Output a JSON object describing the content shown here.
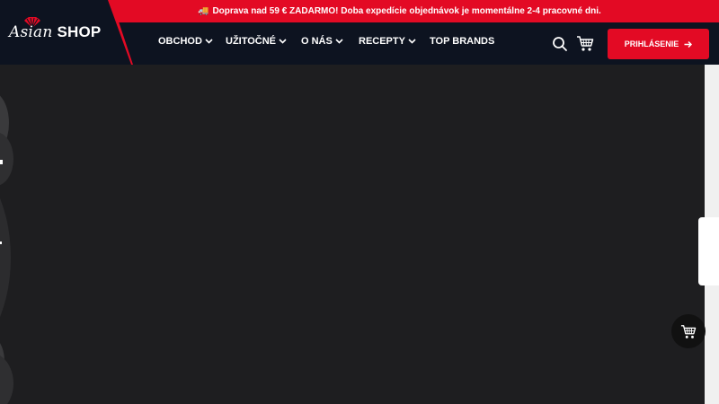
{
  "announcement": {
    "text": "Doprava nad 59 € ZADARMO! Doba expedície objednávok je momentálne 2-4 pracovné dni.",
    "icon": "truck-icon"
  },
  "brand": {
    "name_part1": "Asian",
    "name_part2": "SHOP",
    "logo_icon": "fan-icon"
  },
  "nav": {
    "items": [
      {
        "label": "OBCHOD",
        "has_dropdown": true
      },
      {
        "label": "UŽITOČNÉ",
        "has_dropdown": true
      },
      {
        "label": "O NÁS",
        "has_dropdown": true
      },
      {
        "label": "RECEPTY",
        "has_dropdown": true
      },
      {
        "label": "TOP BRANDS",
        "has_dropdown": false
      }
    ]
  },
  "header_actions": {
    "search_icon": "search-icon",
    "cart_icon": "cart-icon",
    "login_label": "PRIHLÁSENIE",
    "login_icon": "arrow-right-icon"
  },
  "floating": {
    "cart_icon": "cart-icon"
  },
  "colors": {
    "brand_red": "#e30a24",
    "header_bg": "#0d1320",
    "hero_bg": "#1e1e20"
  }
}
